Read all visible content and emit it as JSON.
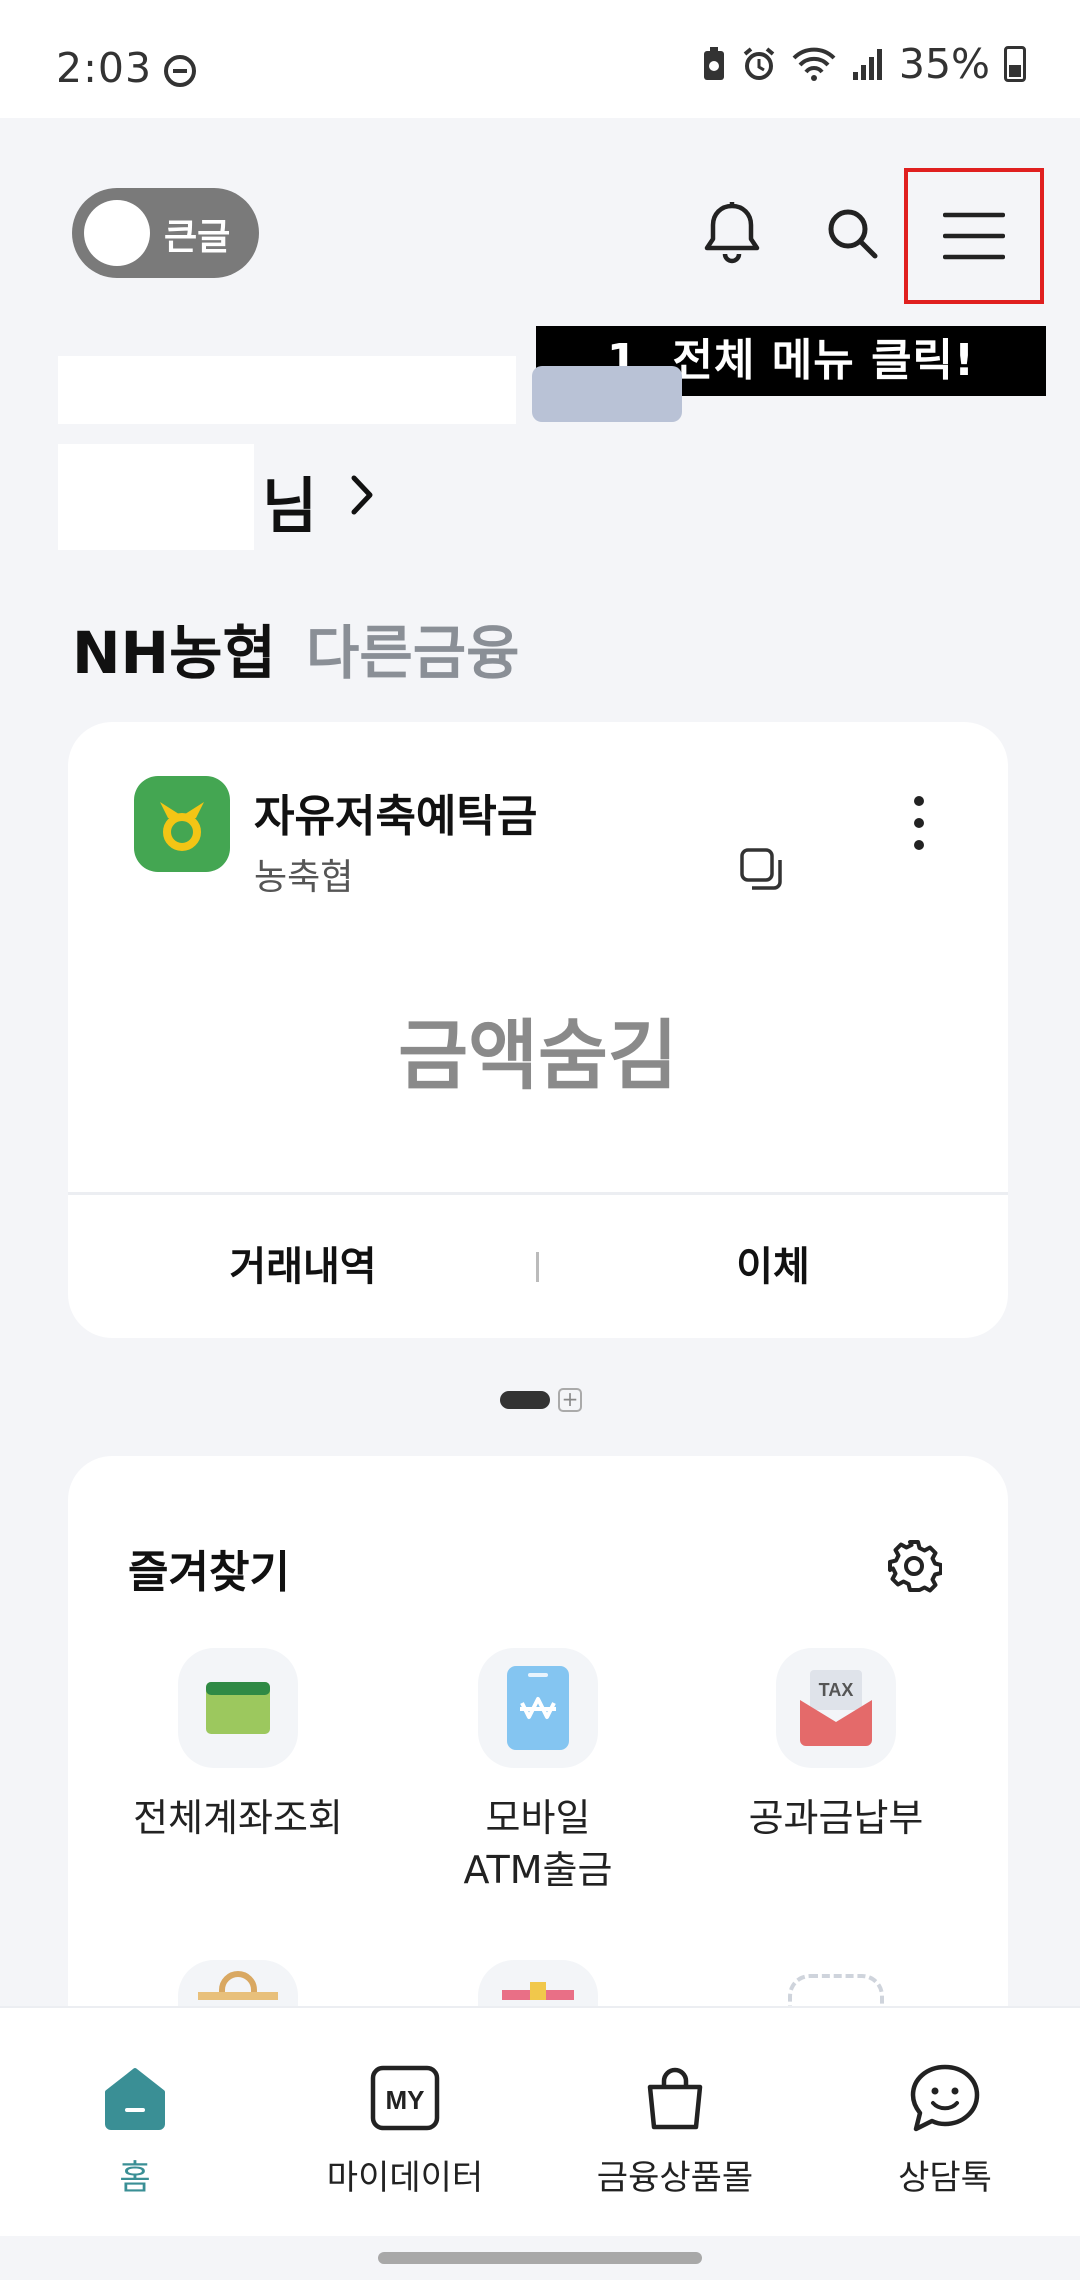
{
  "status_bar": {
    "time": "2:03",
    "battery": "35%"
  },
  "header": {
    "toggle_label": "큰글"
  },
  "annotation": "1. 전체 메뉴 클릭!",
  "greeting": {
    "suffix": "님"
  },
  "tabs": [
    {
      "label": "NH농협",
      "active": true
    },
    {
      "label": "다른금융",
      "active": false
    }
  ],
  "account": {
    "name": "자유저축예탁금",
    "bank": "농축협",
    "amount": "금액숨김",
    "actions": {
      "history": "거래내역",
      "transfer": "이체"
    }
  },
  "favorites": {
    "title": "즐겨찾기",
    "items": [
      {
        "label": "전체계좌조회",
        "icon": "card-icon"
      },
      {
        "label": "모바일\nATM출금",
        "icon": "mobile-atm-icon"
      },
      {
        "label": "공과금납부",
        "icon": "tax-envelope-icon"
      }
    ],
    "tax_text": "TAX"
  },
  "bottom_nav": [
    {
      "label": "홈",
      "icon": "home-icon",
      "active": true
    },
    {
      "label": "마이데이터",
      "icon": "mydata-icon",
      "active": false,
      "icon_text": "MY"
    },
    {
      "label": "금융상품몰",
      "icon": "shopping-bag-icon",
      "active": false
    },
    {
      "label": "상담톡",
      "icon": "chat-smile-icon",
      "active": false
    }
  ],
  "colors": {
    "accent": "#3a8f95",
    "annotation_border": "#e0201f",
    "logo_green": "#44a652"
  }
}
